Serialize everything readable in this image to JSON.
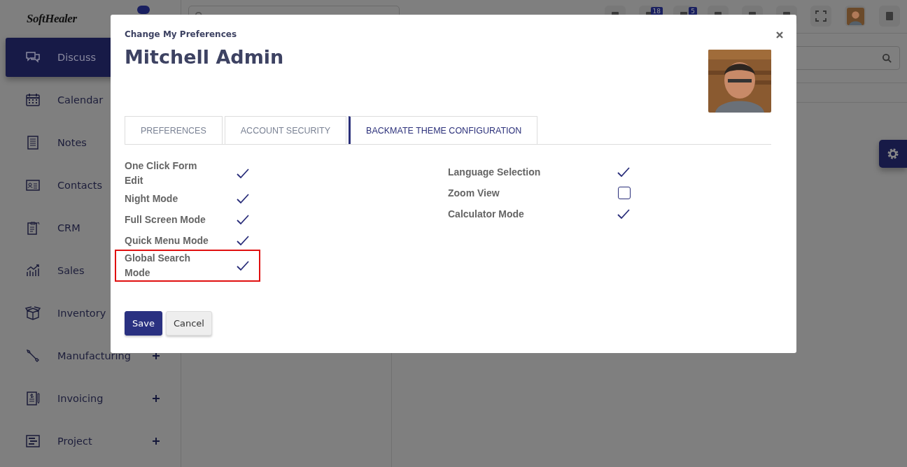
{
  "brand": "SoftHealer",
  "sidebar": {
    "items": [
      {
        "label": "Discuss",
        "selected": true
      },
      {
        "label": "Calendar",
        "selected": false
      },
      {
        "label": "Notes",
        "selected": false
      },
      {
        "label": "Contacts",
        "selected": false
      },
      {
        "label": "CRM",
        "selected": false
      },
      {
        "label": "Sales",
        "selected": false
      },
      {
        "label": "Inventory",
        "selected": false
      },
      {
        "label": "Manufacturing",
        "selected": false,
        "expandable": true
      },
      {
        "label": "Invoicing",
        "selected": false,
        "expandable": true
      },
      {
        "label": "Project",
        "selected": false,
        "expandable": true
      }
    ]
  },
  "topbar": {
    "icons": [
      {
        "kind": "plain"
      },
      {
        "kind": "badge",
        "badge": "18"
      },
      {
        "kind": "badge",
        "badge": "5"
      },
      {
        "kind": "plain"
      },
      {
        "kind": "plain"
      },
      {
        "kind": "plain"
      },
      {
        "kind": "fullscreen"
      },
      {
        "kind": "avatar"
      },
      {
        "kind": "plain"
      }
    ]
  },
  "dialog": {
    "title": "Change My Preferences",
    "user_name": "Mitchell Admin",
    "tabs": [
      {
        "label": "PREFERENCES",
        "selected": false
      },
      {
        "label": "ACCOUNT SECURITY",
        "selected": false
      },
      {
        "label": "BACKMATE THEME CONFIGURATION",
        "selected": true
      }
    ],
    "left_options": [
      {
        "label": "One Click Form Edit",
        "checked": true,
        "highlighted": false
      },
      {
        "label": "Night Mode",
        "checked": true,
        "highlighted": false
      },
      {
        "label": "Full Screen Mode",
        "checked": true,
        "highlighted": false
      },
      {
        "label": "Quick Menu Mode",
        "checked": true,
        "highlighted": false
      },
      {
        "label": "Global Search Mode",
        "checked": true,
        "highlighted": true
      }
    ],
    "right_options": [
      {
        "label": "Language Selection",
        "checked": true,
        "highlighted": false
      },
      {
        "label": "Zoom View",
        "checked": false,
        "highlighted": false
      },
      {
        "label": "Calculator Mode",
        "checked": true,
        "highlighted": false
      }
    ],
    "buttons": [
      {
        "label": "Save",
        "kind": "primary"
      },
      {
        "label": "Cancel",
        "kind": "secondary"
      }
    ]
  }
}
